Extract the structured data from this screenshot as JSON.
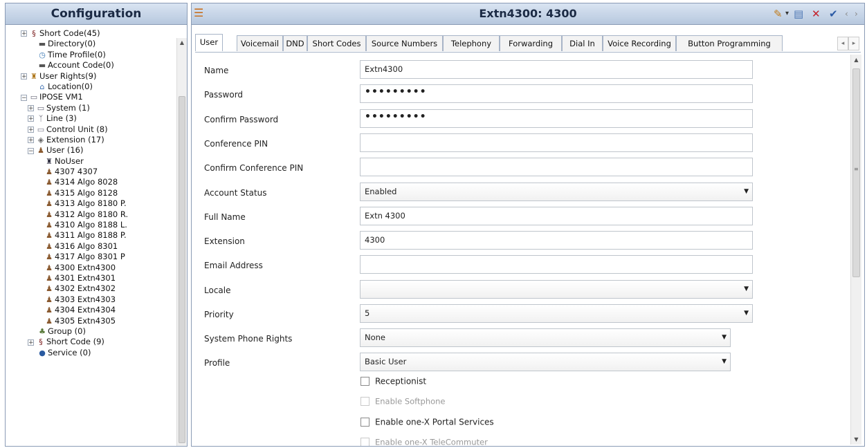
{
  "config_panel": {
    "title": "Configuration"
  },
  "tree": [
    {
      "label": "Short Code(45)",
      "icon": "short-code",
      "indent": 0,
      "exp": "+"
    },
    {
      "label": "Directory(0)",
      "icon": "directory",
      "indent": 1,
      "exp": ""
    },
    {
      "label": "Time Profile(0)",
      "icon": "clock",
      "indent": 1,
      "exp": ""
    },
    {
      "label": "Account Code(0)",
      "icon": "account-code",
      "indent": 1,
      "exp": ""
    },
    {
      "label": "User Rights(9)",
      "icon": "user-rights",
      "indent": 0,
      "exp": "+"
    },
    {
      "label": "Location(0)",
      "icon": "location",
      "indent": 1,
      "exp": ""
    },
    {
      "label": "IPOSE VM1",
      "icon": "server",
      "indent": 0,
      "exp": "−"
    },
    {
      "label": "System (1)",
      "icon": "system",
      "indent": 1,
      "exp": "+"
    },
    {
      "label": "Line (3)",
      "icon": "line",
      "indent": 1,
      "exp": "+"
    },
    {
      "label": "Control Unit (8)",
      "icon": "control-unit",
      "indent": 1,
      "exp": "+"
    },
    {
      "label": "Extension (17)",
      "icon": "extension",
      "indent": 1,
      "exp": "+"
    },
    {
      "label": "User (16)",
      "icon": "user",
      "indent": 1,
      "exp": "−"
    },
    {
      "label": "NoUser",
      "icon": "nouser",
      "indent": 2,
      "exp": ""
    },
    {
      "label": "4307 4307",
      "icon": "user",
      "indent": 2,
      "exp": ""
    },
    {
      "label": "4314 Algo 8028",
      "icon": "user",
      "indent": 2,
      "exp": ""
    },
    {
      "label": "4315 Algo 8128",
      "icon": "user",
      "indent": 2,
      "exp": ""
    },
    {
      "label": "4313 Algo 8180 P.",
      "icon": "user",
      "indent": 2,
      "exp": ""
    },
    {
      "label": "4312 Algo 8180 R.",
      "icon": "user",
      "indent": 2,
      "exp": ""
    },
    {
      "label": "4310 Algo 8188 L.",
      "icon": "user",
      "indent": 2,
      "exp": ""
    },
    {
      "label": "4311 Algo 8188 P.",
      "icon": "user",
      "indent": 2,
      "exp": ""
    },
    {
      "label": "4316 Algo 8301",
      "icon": "user",
      "indent": 2,
      "exp": ""
    },
    {
      "label": "4317 Algo 8301 P",
      "icon": "user",
      "indent": 2,
      "exp": ""
    },
    {
      "label": "4300 Extn4300",
      "icon": "user",
      "indent": 2,
      "exp": "",
      "selected": true
    },
    {
      "label": "4301 Extn4301",
      "icon": "user",
      "indent": 2,
      "exp": ""
    },
    {
      "label": "4302 Extn4302",
      "icon": "user",
      "indent": 2,
      "exp": ""
    },
    {
      "label": "4303 Extn4303",
      "icon": "user",
      "indent": 2,
      "exp": ""
    },
    {
      "label": "4304 Extn4304",
      "icon": "user",
      "indent": 2,
      "exp": ""
    },
    {
      "label": "4305 Extn4305",
      "icon": "user",
      "indent": 2,
      "exp": ""
    },
    {
      "label": "Group (0)",
      "icon": "group",
      "indent": 1,
      "exp": ""
    },
    {
      "label": "Short Code (9)",
      "icon": "short-code",
      "indent": 1,
      "exp": "+"
    },
    {
      "label": "Service (0)",
      "icon": "service",
      "indent": 1,
      "exp": ""
    }
  ],
  "main_panel": {
    "title": "Extn4300: 4300"
  },
  "tabs": [
    "User",
    "Voicemail",
    "DND",
    "Short Codes",
    "Source Numbers",
    "Telephony",
    "Forwarding",
    "Dial In",
    "Voice Recording",
    "Button Programming"
  ],
  "active_tab": "User",
  "form": {
    "name": {
      "label": "Name",
      "value": "Extn4300"
    },
    "password": {
      "label": "Password",
      "value": "•••••••••"
    },
    "confirm_password": {
      "label": "Confirm Password",
      "value": "•••••••••"
    },
    "conference_pin": {
      "label": "Conference PIN",
      "value": ""
    },
    "confirm_conference_pin": {
      "label": "Confirm Conference PIN",
      "value": ""
    },
    "account_status": {
      "label": "Account Status",
      "value": "Enabled"
    },
    "full_name": {
      "label": "Full Name",
      "value": "Extn 4300"
    },
    "extension": {
      "label": "Extension",
      "value": "4300"
    },
    "email_address": {
      "label": "Email Address",
      "value": ""
    },
    "locale": {
      "label": "Locale",
      "value": ""
    },
    "priority": {
      "label": "Priority",
      "value": "5"
    },
    "system_phone_rights": {
      "label": "System Phone Rights",
      "value": "None"
    },
    "profile": {
      "label": "Profile",
      "value": "Basic User"
    }
  },
  "checkboxes": {
    "receptionist": {
      "label": "Receptionist",
      "checked": false,
      "enabled": true
    },
    "enable_softphone": {
      "label": "Enable Softphone",
      "checked": false,
      "enabled": false
    },
    "enable_onex_portal": {
      "label": "Enable one-X Portal Services",
      "checked": false,
      "enabled": true
    },
    "enable_onex_telecommuter": {
      "label": "Enable one-X TeleCommuter",
      "checked": false,
      "enabled": false
    }
  }
}
